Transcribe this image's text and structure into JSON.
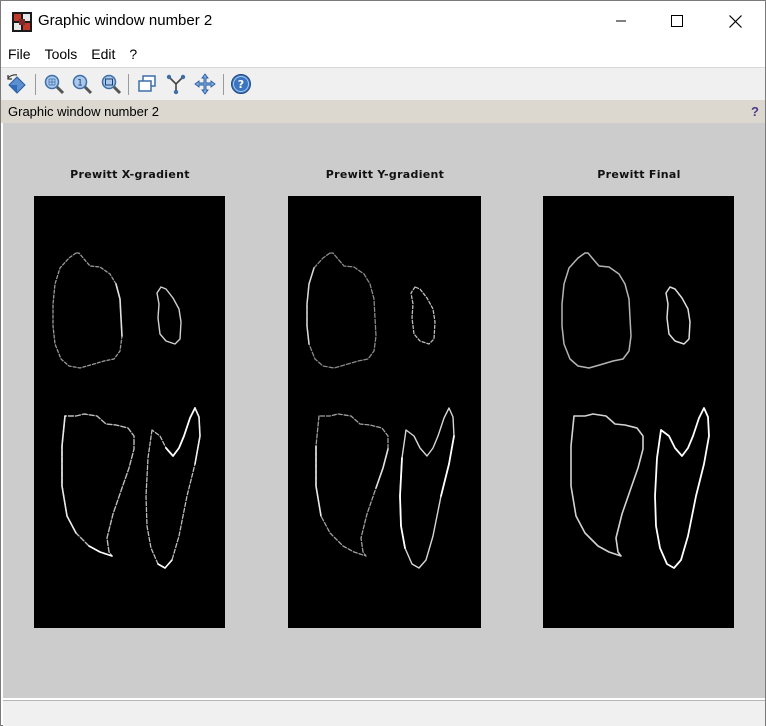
{
  "window": {
    "title": "Graphic window number 2"
  },
  "menu": [
    {
      "label": "File"
    },
    {
      "label": "Tools"
    },
    {
      "label": "Edit"
    },
    {
      "label": "?"
    }
  ],
  "toolbar": {
    "icons": [
      "rotate-icon",
      "zoom-area-icon",
      "zoom-reset-icon",
      "zoom-icon",
      "datatips-icon",
      "graph-icon",
      "pan-icon",
      "help-icon"
    ]
  },
  "infobar": {
    "label": "Graphic window number 2",
    "help": "?"
  },
  "plots": [
    {
      "title": "Prewitt X-gradient"
    },
    {
      "title": "Prewitt Y-gradient"
    },
    {
      "title": "Prewitt Final"
    }
  ],
  "colors": {
    "canvas": "#cccccc",
    "plot_bg": "#000000",
    "infobar": "#dcd8d0"
  }
}
